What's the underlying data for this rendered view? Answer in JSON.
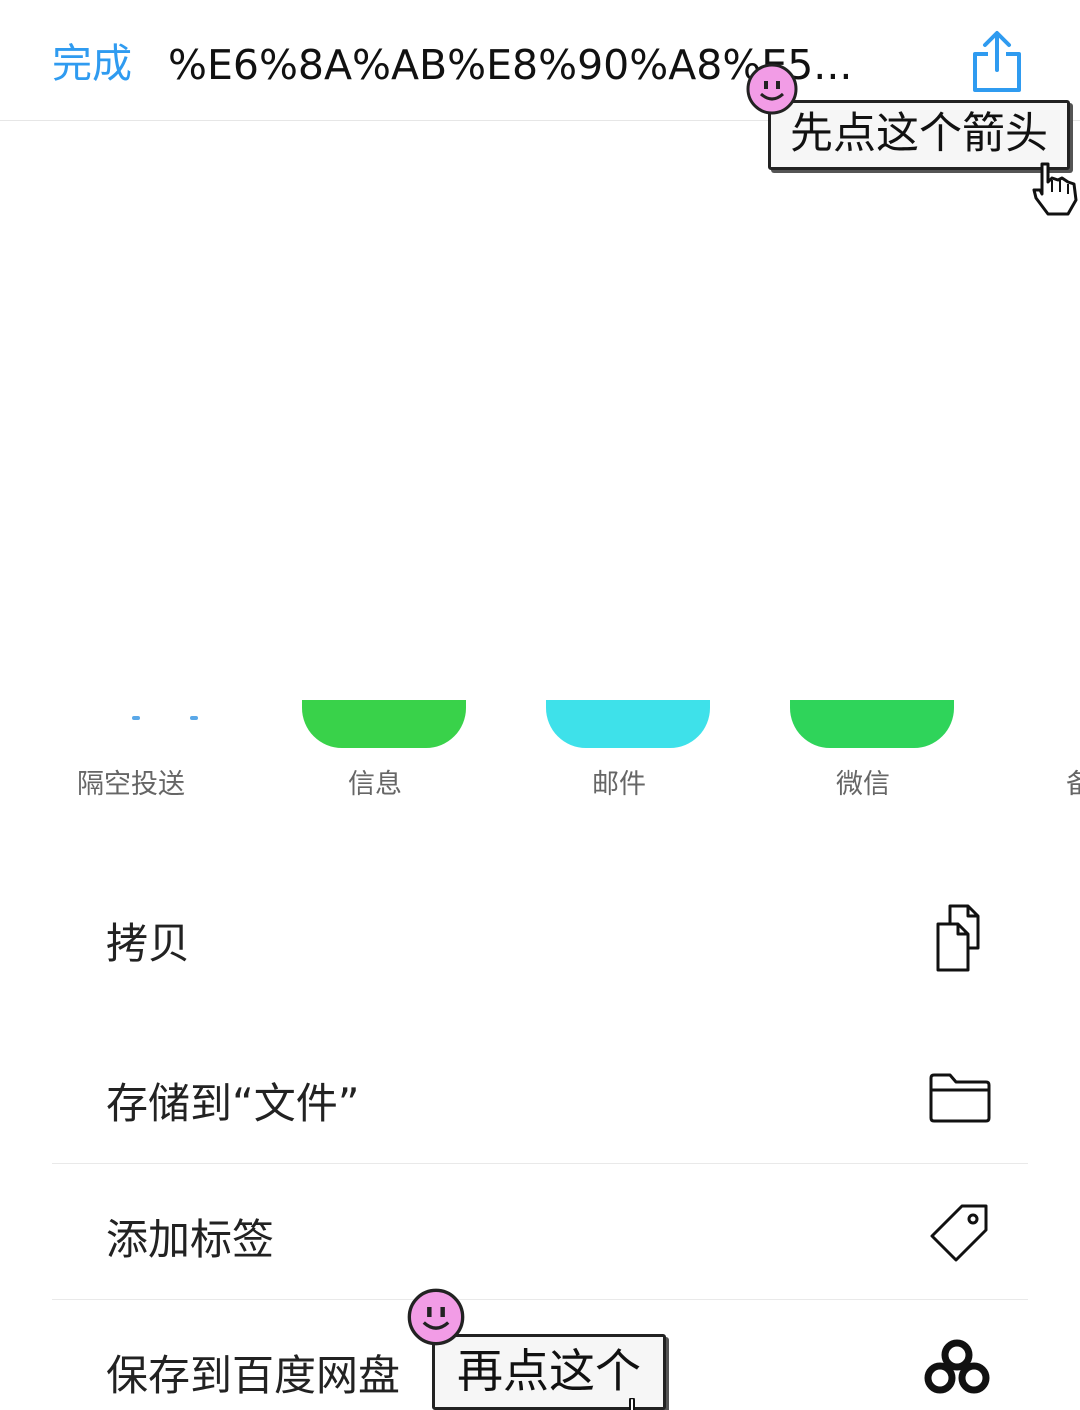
{
  "navbar": {
    "done_label": "完成",
    "title": "%E6%8A%AB%E8%90%A8%E5...",
    "share_icon": "share-up-arrow-icon"
  },
  "annotations": {
    "tip_first": "先点这个箭头",
    "tip_second": "再点这个",
    "sticker_icon": "smiley-face-icon",
    "pointer_icon": "hand-pointer-icon",
    "sticker_color": "#f29ce6"
  },
  "share_targets": [
    {
      "label": "隔空投送",
      "icon": "airdrop-icon",
      "color": "#5aa8e8"
    },
    {
      "label": "信息",
      "icon": "messages-icon",
      "color": "#39d24a"
    },
    {
      "label": "邮件",
      "icon": "mail-icon",
      "color": "#3ee1ea"
    },
    {
      "label": "微信",
      "icon": "wechat-icon",
      "color": "#2fd45a"
    },
    {
      "label": "备",
      "icon": "notes-icon",
      "color": "#f5c400"
    }
  ],
  "actions": [
    {
      "label": "拷贝",
      "icon": "copy-icon"
    },
    {
      "label": "存储到“文件”",
      "icon": "folder-icon"
    },
    {
      "label": "添加标签",
      "icon": "tag-icon"
    },
    {
      "label": "保存到百度网盘",
      "icon": "baidu-netdisk-icon"
    }
  ]
}
